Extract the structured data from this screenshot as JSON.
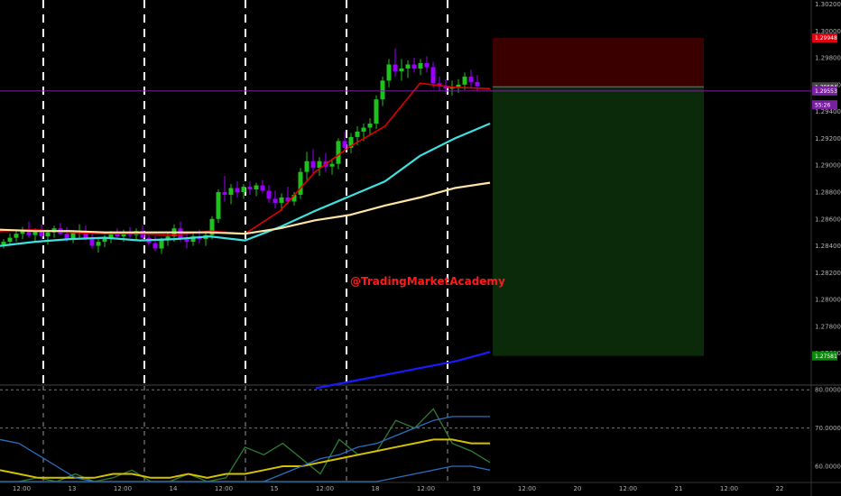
{
  "chart_data": [
    {
      "type": "candlestick",
      "watermark": "@TradingMarketAcademy",
      "ylim": [
        1.2737,
        1.3023
      ],
      "y_ticks": [
        "1.30200",
        "1.30000",
        "1.29800",
        "1.29600",
        "1.29400",
        "1.29200",
        "1.29000",
        "1.28800",
        "1.28600",
        "1.28400",
        "1.28200",
        "1.28000",
        "1.27800",
        "1.27600"
      ],
      "current_price": 1.29553,
      "price_labels": [
        {
          "value": 1.29948,
          "text": "1.29948",
          "color": "#e0000f"
        },
        {
          "value": 1.29584,
          "text": "1.29584",
          "color": "#454545"
        },
        {
          "value": 1.29553,
          "text": "1.29553",
          "color": "#7b1fa2"
        },
        {
          "value": 1.2945,
          "text": "55:26",
          "color": "#7b1fa2"
        },
        {
          "value": 1.27581,
          "text": "1.27581",
          "color": "#0a8a0a"
        }
      ],
      "position_box": {
        "entry": 1.29584,
        "stop_loss": 1.29948,
        "take_profit": 1.27581
      },
      "session_separator_x": [
        "12:00",
        "13",
        "12:00",
        "14",
        "12:00"
      ],
      "moving_averages": [
        {
          "color": "#e00000",
          "values": [
            1.2851,
            1.2852,
            1.285,
            1.2849,
            1.2849,
            1.2848,
            1.2851,
            1.2849,
            1.2866,
            1.2895,
            1.2914,
            1.2929,
            1.2961,
            1.2958,
            1.2957
          ]
        },
        {
          "color": "#3fe0e0",
          "values": [
            1.284,
            1.2843,
            1.2845,
            1.2846,
            1.2844,
            1.2845,
            1.2847,
            1.2844,
            1.2854,
            1.2866,
            1.2877,
            1.2888,
            1.2907,
            1.292,
            1.2931
          ]
        },
        {
          "color": "#ffe4a8",
          "values": [
            1.2852,
            1.2851,
            1.2851,
            1.285,
            1.285,
            1.285,
            1.285,
            1.2849,
            1.2853,
            1.2859,
            1.2863,
            1.287,
            1.2876,
            1.2883,
            1.2887
          ]
        },
        {
          "color": "#1a1aff",
          "values": [
            1.2734,
            1.2739,
            1.2744,
            1.2749,
            1.2754,
            1.2761
          ]
        }
      ]
    },
    {
      "type": "line",
      "ylim": [
        56.0,
        81.0
      ],
      "y_ticks": [
        "80.00000",
        "70.00000",
        "60.00000"
      ],
      "levels": [
        80,
        70
      ],
      "series": [
        {
          "color": "#2e7d32",
          "values": [
            52,
            54,
            57,
            56,
            58,
            55,
            57,
            59,
            53,
            56,
            58,
            54,
            57,
            65,
            63,
            66,
            62,
            58,
            67,
            63,
            64,
            72,
            70,
            75,
            66,
            64,
            61
          ]
        },
        {
          "color": "#d4c200",
          "values": [
            59,
            58,
            57,
            57,
            57,
            57,
            58,
            58,
            57,
            57,
            58,
            57,
            58,
            58,
            59,
            60,
            60,
            61,
            62,
            63,
            64,
            65,
            66,
            67,
            67,
            66,
            66
          ]
        },
        {
          "color": "#2a6fc0",
          "values": [
            67,
            66,
            63,
            60,
            57,
            55,
            53,
            52,
            51,
            51,
            52,
            52,
            53,
            54,
            56,
            58,
            60,
            62,
            63,
            65,
            66,
            68,
            70,
            72,
            73,
            73,
            73
          ]
        },
        {
          "color": "#2a6fc0",
          "values": [
            48,
            47,
            46,
            46,
            47,
            47,
            48,
            48,
            48,
            48,
            49,
            49,
            49,
            49,
            50,
            51,
            52,
            53,
            54,
            55,
            56,
            57,
            58,
            59,
            60,
            60,
            59
          ]
        }
      ]
    }
  ],
  "x_axis": {
    "ticks": [
      "12:00",
      "13",
      "12:00",
      "14",
      "12:00",
      "15",
      "12:00",
      "18",
      "12:00",
      "19",
      "12:00",
      "20",
      "12:00",
      "21",
      "12:00",
      "22"
    ]
  },
  "candles": [
    [
      1.2841,
      1.2845,
      1.2838,
      1.2843
    ],
    [
      1.2843,
      1.2849,
      1.284,
      1.2846
    ],
    [
      1.2846,
      1.2852,
      1.2843,
      1.2849
    ],
    [
      1.2849,
      1.2854,
      1.2845,
      1.2851
    ],
    [
      1.2851,
      1.2858,
      1.2846,
      1.2848
    ],
    [
      1.2848,
      1.2853,
      1.2843,
      1.2852
    ],
    [
      1.2852,
      1.2856,
      1.2845,
      1.2847
    ],
    [
      1.2847,
      1.2852,
      1.2841,
      1.285
    ],
    [
      1.285,
      1.2855,
      1.2846,
      1.2853
    ],
    [
      1.2853,
      1.2857,
      1.2848,
      1.2849
    ],
    [
      1.2849,
      1.2854,
      1.2843,
      1.2845
    ],
    [
      1.2845,
      1.2851,
      1.2842,
      1.285
    ],
    [
      1.285,
      1.2856,
      1.2846,
      1.2851
    ],
    [
      1.2851,
      1.2855,
      1.2844,
      1.2846
    ],
    [
      1.2846,
      1.285,
      1.2838,
      1.284
    ],
    [
      1.284,
      1.2846,
      1.2835,
      1.2843
    ],
    [
      1.2843,
      1.2848,
      1.2839,
      1.2846
    ],
    [
      1.2846,
      1.2851,
      1.2842,
      1.2849
    ],
    [
      1.2849,
      1.2853,
      1.2845,
      1.2847
    ],
    [
      1.2847,
      1.2852,
      1.2843,
      1.285
    ],
    [
      1.285,
      1.2854,
      1.2846,
      1.2848
    ],
    [
      1.2848,
      1.2853,
      1.2844,
      1.2851
    ],
    [
      1.2851,
      1.2855,
      1.2845,
      1.2846
    ],
    [
      1.2846,
      1.285,
      1.284,
      1.2842
    ],
    [
      1.2842,
      1.2847,
      1.2836,
      1.2838
    ],
    [
      1.2838,
      1.2846,
      1.2834,
      1.2844
    ],
    [
      1.2844,
      1.285,
      1.284,
      1.2847
    ],
    [
      1.2847,
      1.2856,
      1.2843,
      1.2853
    ],
    [
      1.2853,
      1.2858,
      1.2843,
      1.2845
    ],
    [
      1.2845,
      1.2849,
      1.2838,
      1.2843
    ],
    [
      1.2843,
      1.285,
      1.284,
      1.2847
    ],
    [
      1.2847,
      1.2852,
      1.2842,
      1.2845
    ],
    [
      1.2845,
      1.285,
      1.284,
      1.2848
    ],
    [
      1.2848,
      1.2862,
      1.2845,
      1.286
    ],
    [
      1.286,
      1.2882,
      1.2857,
      1.288
    ],
    [
      1.288,
      1.2892,
      1.2873,
      1.2878
    ],
    [
      1.2878,
      1.2886,
      1.2871,
      1.2883
    ],
    [
      1.2883,
      1.2888,
      1.2876,
      1.288
    ],
    [
      1.288,
      1.2886,
      1.2875,
      1.2884
    ],
    [
      1.2884,
      1.2888,
      1.2878,
      1.2882
    ],
    [
      1.2882,
      1.2887,
      1.2877,
      1.2885
    ],
    [
      1.2885,
      1.2889,
      1.2879,
      1.2881
    ],
    [
      1.2881,
      1.2885,
      1.2872,
      1.2875
    ],
    [
      1.2875,
      1.2881,
      1.2868,
      1.2872
    ],
    [
      1.2872,
      1.2879,
      1.2866,
      1.2876
    ],
    [
      1.2876,
      1.2884,
      1.2871,
      1.2873
    ],
    [
      1.2873,
      1.288,
      1.287,
      1.2878
    ],
    [
      1.2878,
      1.2898,
      1.2875,
      1.2895
    ],
    [
      1.2895,
      1.291,
      1.2889,
      1.2903
    ],
    [
      1.2903,
      1.2912,
      1.2894,
      1.2898
    ],
    [
      1.2898,
      1.2906,
      1.2892,
      1.2903
    ],
    [
      1.2903,
      1.2909,
      1.2895,
      1.2899
    ],
    [
      1.2899,
      1.2905,
      1.2893,
      1.2901
    ],
    [
      1.2901,
      1.292,
      1.2897,
      1.2918
    ],
    [
      1.2918,
      1.2925,
      1.291,
      1.2913
    ],
    [
      1.2913,
      1.2924,
      1.2909,
      1.2921
    ],
    [
      1.2921,
      1.2929,
      1.2915,
      1.2925
    ],
    [
      1.2925,
      1.2931,
      1.2918,
      1.2928
    ],
    [
      1.2928,
      1.2935,
      1.2922,
      1.2931
    ],
    [
      1.2931,
      1.2952,
      1.2927,
      1.2949
    ],
    [
      1.2949,
      1.2966,
      1.2944,
      1.2963
    ],
    [
      1.2963,
      1.2979,
      1.2958,
      1.2975
    ],
    [
      1.2975,
      1.2987,
      1.2966,
      1.297
    ],
    [
      1.297,
      1.2979,
      1.2963,
      1.2972
    ],
    [
      1.2972,
      1.2978,
      1.2965,
      1.2975
    ],
    [
      1.2975,
      1.298,
      1.2969,
      1.2972
    ],
    [
      1.2972,
      1.2979,
      1.2967,
      1.2976
    ],
    [
      1.2976,
      1.2981,
      1.2969,
      1.2973
    ],
    [
      1.2973,
      1.2977,
      1.2958,
      1.2961
    ],
    [
      1.2961,
      1.2966,
      1.2955,
      1.2959
    ],
    [
      1.2959,
      1.2964,
      1.2953,
      1.2957
    ],
    [
      1.2957,
      1.2963,
      1.2952,
      1.2958
    ],
    [
      1.2958,
      1.2964,
      1.2954,
      1.296
    ],
    [
      1.296,
      1.2969,
      1.2956,
      1.2966
    ],
    [
      1.2966,
      1.2971,
      1.2958,
      1.2962
    ],
    [
      1.2962,
      1.2967,
      1.2955,
      1.2959
    ]
  ]
}
